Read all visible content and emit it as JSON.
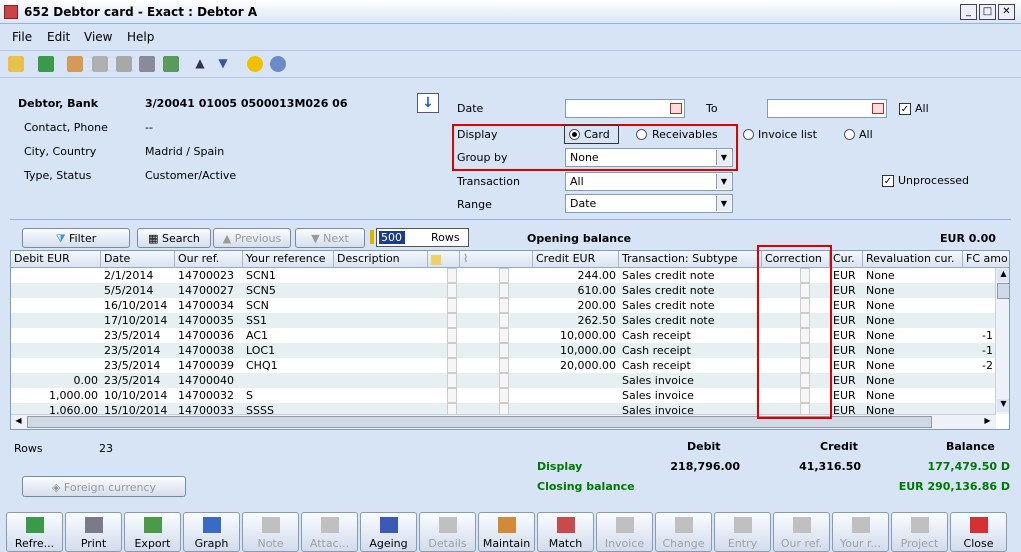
{
  "window": {
    "title": "652 Debtor card - Exact : Debtor A"
  },
  "menu": [
    "File",
    "Edit",
    "View",
    "Help"
  ],
  "info": {
    "rows": [
      {
        "label": "Debtor, Bank",
        "value": "3/20041 01005 0500013M026 06"
      },
      {
        "label": "Contact, Phone",
        "value": "--"
      },
      {
        "label": "City, Country",
        "value": "Madrid / Spain"
      },
      {
        "label": "Type, Status",
        "value": "Customer/Active"
      }
    ]
  },
  "filters": {
    "date_label": "Date",
    "to_label": "To",
    "all_label": "All",
    "display_label": "Display",
    "display_options": [
      "Card",
      "Receivables",
      "Invoice list",
      "All"
    ],
    "groupby_label": "Group by",
    "groupby_value": "None",
    "transaction_label": "Transaction",
    "transaction_value": "All",
    "range_label": "Range",
    "range_value": "Date",
    "unprocessed_label": "Unprocessed"
  },
  "gridbar": {
    "filter": "Filter",
    "search": "Search",
    "previous": "Previous",
    "next": "Next",
    "rows_value": "500",
    "rows_label": "Rows",
    "opening_label": "Opening balance",
    "opening_value": "EUR 0.00"
  },
  "grid": {
    "columns": [
      "Debit EUR",
      "Date",
      "Our ref.",
      "Your reference",
      "Description",
      "",
      "",
      "Credit EUR",
      "Transaction: Subtype",
      "Correction",
      "Cur.",
      "Revaluation cur.",
      "FC amo"
    ],
    "rows": [
      {
        "debit": "",
        "date": "2/1/2014",
        "ourref": "14700023",
        "yourref": "SCN1",
        "credit": "244.00",
        "type": "Sales credit note",
        "cur": "EUR",
        "reval": "None",
        "fc": ""
      },
      {
        "debit": "",
        "date": "5/5/2014",
        "ourref": "14700027",
        "yourref": "SCN5",
        "credit": "610.00",
        "type": "Sales credit note",
        "cur": "EUR",
        "reval": "None",
        "fc": ""
      },
      {
        "debit": "",
        "date": "16/10/2014",
        "ourref": "14700034",
        "yourref": "SCN",
        "credit": "200.00",
        "type": "Sales credit note",
        "cur": "EUR",
        "reval": "None",
        "fc": ""
      },
      {
        "debit": "",
        "date": "17/10/2014",
        "ourref": "14700035",
        "yourref": "SS1",
        "credit": "262.50",
        "type": "Sales credit note",
        "cur": "EUR",
        "reval": "None",
        "fc": ""
      },
      {
        "debit": "",
        "date": "23/5/2014",
        "ourref": "14700036",
        "yourref": "AC1",
        "credit": "10,000.00",
        "type": "Cash receipt",
        "cur": "EUR",
        "reval": "None",
        "fc": "-1"
      },
      {
        "debit": "",
        "date": "23/5/2014",
        "ourref": "14700038",
        "yourref": "LOC1",
        "credit": "10,000.00",
        "type": "Cash receipt",
        "cur": "EUR",
        "reval": "None",
        "fc": "-1"
      },
      {
        "debit": "",
        "date": "23/5/2014",
        "ourref": "14700039",
        "yourref": "CHQ1",
        "credit": "20,000.00",
        "type": "Cash receipt",
        "cur": "EUR",
        "reval": "None",
        "fc": "-2"
      },
      {
        "debit": "0.00",
        "date": "23/5/2014",
        "ourref": "14700040",
        "yourref": "",
        "credit": "",
        "type": "Sales invoice",
        "cur": "EUR",
        "reval": "None",
        "fc": ""
      },
      {
        "debit": "1,000.00",
        "date": "10/10/2014",
        "ourref": "14700032",
        "yourref": "S",
        "credit": "",
        "type": "Sales invoice",
        "cur": "EUR",
        "reval": "None",
        "fc": ""
      },
      {
        "debit": "1,060.00",
        "date": "15/10/2014",
        "ourref": "14700033",
        "yourref": "SSSS",
        "credit": "",
        "type": "Sales invoice",
        "cur": "EUR",
        "reval": "None",
        "fc": ""
      }
    ]
  },
  "summary": {
    "rows_label": "Rows",
    "rows_value": "23",
    "debit_label": "Debit",
    "credit_label": "Credit",
    "balance_label": "Balance",
    "display_label": "Display",
    "display_debit": "218,796.00",
    "display_credit": "41,316.50",
    "display_balance": "177,479.50 D",
    "closing_label": "Closing balance",
    "closing_value": "EUR 290,136.86 D",
    "foreign_currency": "Foreign currency"
  },
  "bottom_buttons": [
    {
      "label": "Refre...",
      "icon": "refresh-icon",
      "enabled": true
    },
    {
      "label": "Print",
      "icon": "printer-icon",
      "enabled": true
    },
    {
      "label": "Export",
      "icon": "export-icon",
      "enabled": true
    },
    {
      "label": "Graph",
      "icon": "graph-icon",
      "enabled": true
    },
    {
      "label": "Note",
      "icon": "note-icon",
      "enabled": false
    },
    {
      "label": "Attac...",
      "icon": "paperclip-icon",
      "enabled": false
    },
    {
      "label": "Ageing",
      "icon": "ageing-icon",
      "enabled": true
    },
    {
      "label": "Details",
      "icon": "details-icon",
      "enabled": false
    },
    {
      "label": "Maintain",
      "icon": "wrench-icon",
      "enabled": true
    },
    {
      "label": "Match",
      "icon": "match-icon",
      "enabled": true
    },
    {
      "label": "Invoice",
      "icon": "invoice-icon",
      "enabled": false
    },
    {
      "label": "Change",
      "icon": "change-icon",
      "enabled": false
    },
    {
      "label": "Entry",
      "icon": "entry-icon",
      "enabled": false
    },
    {
      "label": "Our ref.",
      "icon": "our-ref-icon",
      "enabled": false
    },
    {
      "label": "Your r...",
      "icon": "your-ref-icon",
      "enabled": false
    },
    {
      "label": "Project",
      "icon": "project-icon",
      "enabled": false
    },
    {
      "label": "Close",
      "icon": "close-icon",
      "enabled": true
    }
  ]
}
